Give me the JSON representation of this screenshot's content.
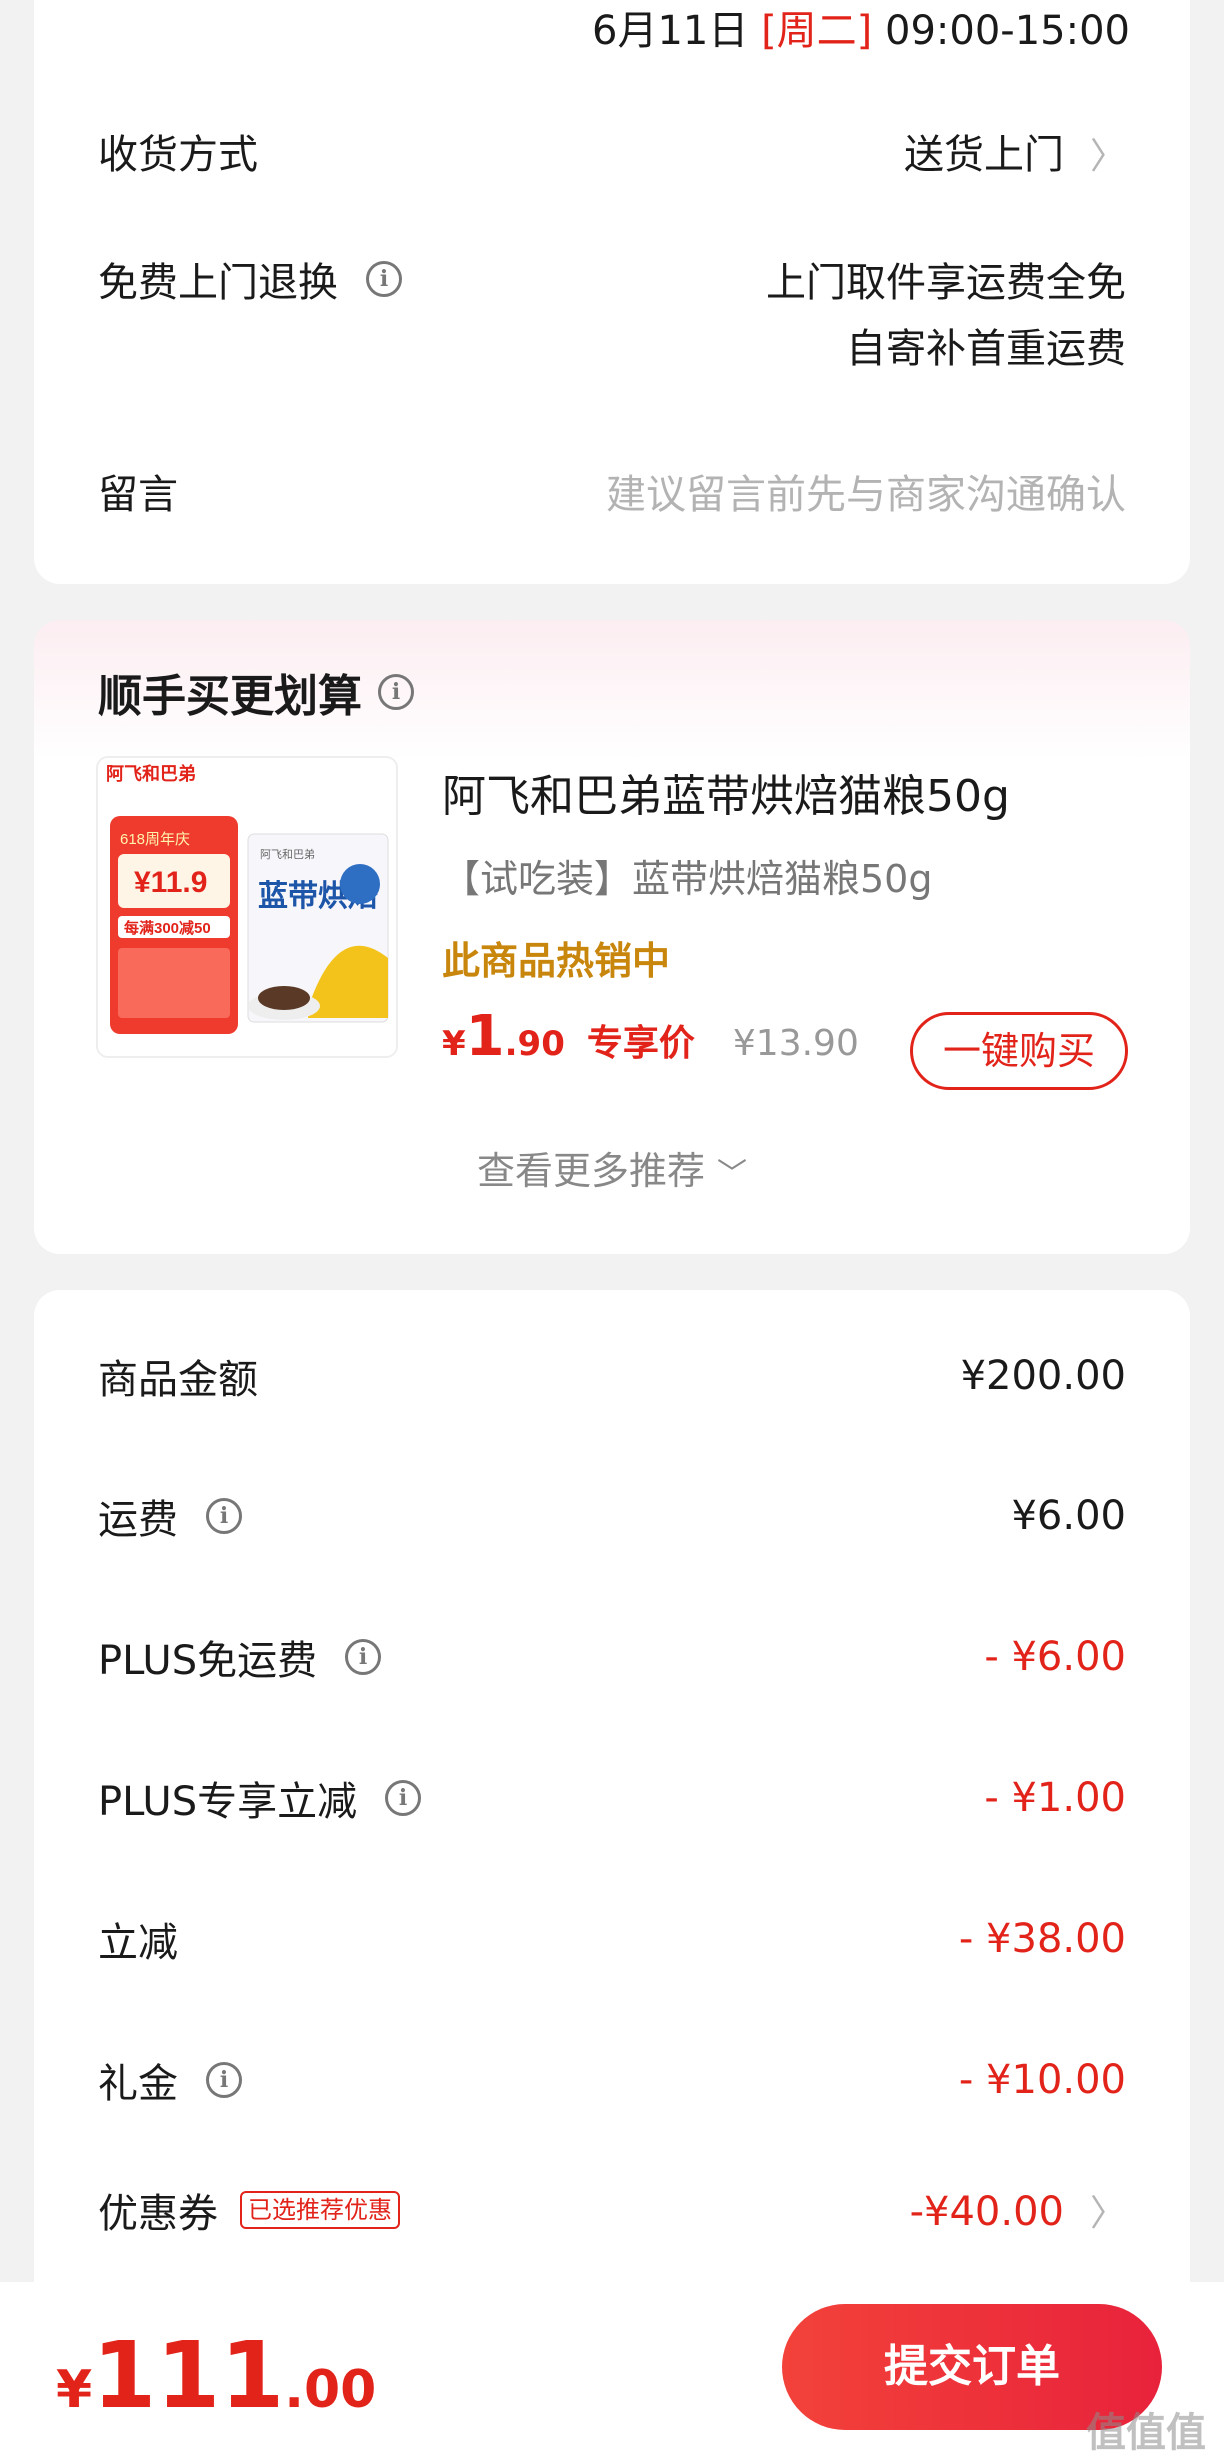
{
  "delivery_time": {
    "date": "6月11日",
    "weekday": "[周二]",
    "time": "09:00-15:00"
  },
  "shipping": {
    "label": "收货方式",
    "value": "送货上门"
  },
  "free_return": {
    "label": "免费上门退换",
    "line1": "上门取件享运费全免",
    "line2": "自寄补首重运费"
  },
  "message": {
    "label": "留言",
    "placeholder": "建议留言前先与商家沟通确认"
  },
  "addon": {
    "title": "顺手买更划算",
    "product": {
      "name": "阿飞和巴弟蓝带烘焙猫粮50g",
      "spec": "【试吃装】蓝带烘焙猫粮50g",
      "hot": "此商品热销中",
      "price_yen": "¥",
      "price_int": "1",
      "price_dec": ".90",
      "price_tag": "专享价",
      "orig_price": "¥13.90",
      "buy_label": "一键购买"
    },
    "thumb": {
      "brand": "阿飞和巴弟",
      "event": "618周年庆",
      "deal_price": "¥11.9",
      "promo": "每满300减50",
      "pack_brand": "阿飞和巴弟",
      "pack_name": "蓝带烘焙"
    },
    "more_label": "查看更多推荐"
  },
  "summary": {
    "rows": [
      {
        "label": "商品金额",
        "value": "¥200.00"
      },
      {
        "label": "运费",
        "value": "¥6.00"
      },
      {
        "label": "PLUS免运费",
        "value": "- ¥6.00"
      },
      {
        "label": "PLUS专享立减",
        "value": "- ¥1.00"
      },
      {
        "label": "立减",
        "value": "- ¥38.00"
      },
      {
        "label": "礼金",
        "value": "- ¥10.00"
      },
      {
        "label": "优惠券",
        "tag": "已选推荐优惠",
        "value": "-¥40.00"
      }
    ]
  },
  "footer": {
    "total_yen": "¥",
    "total_int": "111",
    "total_dec": ".00",
    "submit_label": "提交订单"
  },
  "watermark": "值值值",
  "colors": {
    "accent": "#e2231a",
    "hot": "#c8860d",
    "background": "#f2f2f2"
  },
  "icons": {
    "info": "info-circle-icon",
    "chevron_right": "chevron-right-icon",
    "chevron_down": "chevron-down-icon"
  }
}
